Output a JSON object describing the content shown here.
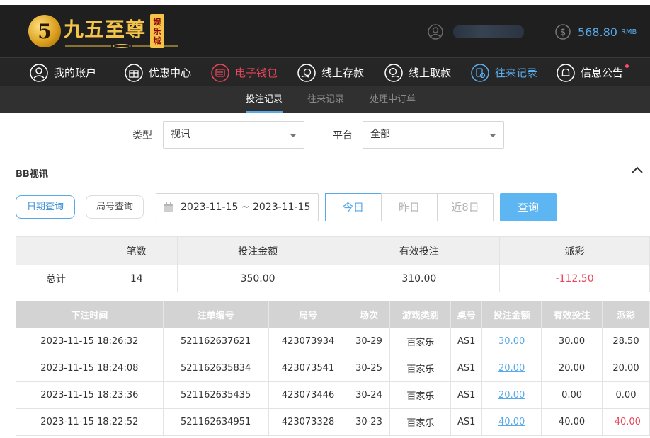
{
  "brand": {
    "name": "九五至尊",
    "tag_chars": [
      "娱",
      "乐",
      "城"
    ]
  },
  "header": {
    "balance_amount": "568.80",
    "balance_unit": "RMB"
  },
  "nav": {
    "items": [
      {
        "label": "我的账户",
        "icon": "user-icon"
      },
      {
        "label": "优惠中心",
        "icon": "gift-icon"
      },
      {
        "label": "电子钱包",
        "icon": "wallet-icon"
      },
      {
        "label": "线上存款",
        "icon": "deposit-icon"
      },
      {
        "label": "线上取款",
        "icon": "withdraw-icon"
      },
      {
        "label": "往来记录",
        "icon": "record-icon"
      },
      {
        "label": "信息公告",
        "icon": "bell-icon"
      }
    ]
  },
  "subnav": {
    "tabs": [
      "投注记录",
      "往来记录",
      "处理中订单"
    ],
    "active": "投注记录"
  },
  "filters": {
    "type_label": "类型",
    "type_value": "视讯",
    "platform_label": "平台",
    "platform_value": "全部"
  },
  "section": {
    "title": "BB视讯"
  },
  "query": {
    "date_query_label": "日期查询",
    "round_query_label": "局号查询",
    "date_range": "2023-11-15 ~ 2023-11-15",
    "quick_today": "今日",
    "quick_yesterday": "昨日",
    "quick_8days": "近8日",
    "submit_label": "查询"
  },
  "summary": {
    "headers": [
      "",
      "笔数",
      "投注金额",
      "有效投注",
      "派彩"
    ],
    "row": [
      "总计",
      "14",
      "350.00",
      "310.00",
      "-112.50"
    ]
  },
  "records": {
    "headers": [
      "下注时间",
      "注单编号",
      "局号",
      "场次",
      "游戏类别",
      "桌号",
      "投注金额",
      "有效投注",
      "派彩"
    ],
    "rows": [
      [
        "2023-11-15 18:26:32",
        "521162637621",
        "423073934",
        "30-29",
        "百家乐",
        "AS1",
        "30.00",
        "30.00",
        "28.50"
      ],
      [
        "2023-11-15 18:24:08",
        "521162635834",
        "423073541",
        "30-25",
        "百家乐",
        "AS1",
        "20.00",
        "20.00",
        "20.00"
      ],
      [
        "2023-11-15 18:23:36",
        "521162635435",
        "423073446",
        "30-24",
        "百家乐",
        "AS1",
        "20.00",
        "0.00",
        "0.00"
      ],
      [
        "2023-11-15 18:22:52",
        "521162634951",
        "423073328",
        "30-23",
        "百家乐",
        "AS1",
        "40.00",
        "40.00",
        "-40.00"
      ]
    ]
  },
  "colors": {
    "accent": "#58a9e8",
    "negative": "#e8465a",
    "header_bg": "#1f1f1f",
    "gold": "#f3c34a"
  }
}
